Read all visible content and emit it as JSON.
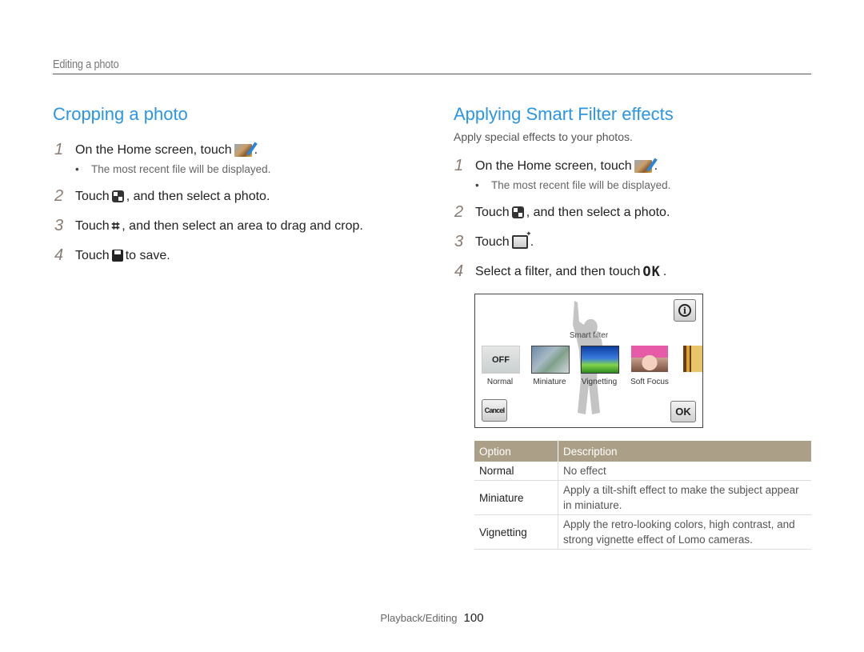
{
  "header": {
    "section": "Editing a photo"
  },
  "cropping": {
    "title": "Cropping a photo",
    "steps": [
      {
        "num": "1",
        "pre": "On the Home screen, touch",
        "icon": "gallery-icon",
        "post": ".",
        "sub": "The most recent file will be displayed."
      },
      {
        "num": "2",
        "pre": "Touch",
        "icon": "thumbnail-grid-icon",
        "post": ", and then select a photo."
      },
      {
        "num": "3",
        "pre": "Touch",
        "icon": "crop-icon",
        "post": ", and then select an area to drag and crop."
      },
      {
        "num": "4",
        "pre": "Touch",
        "icon": "save-icon",
        "post": " to save."
      }
    ]
  },
  "smart_filter": {
    "title": "Applying Smart Filter effects",
    "intro": "Apply special effects to your photos.",
    "steps": [
      {
        "num": "1",
        "pre": "On the Home screen, touch",
        "icon": "gallery-icon",
        "post": ".",
        "sub": "The most recent file will be displayed."
      },
      {
        "num": "2",
        "pre": "Touch",
        "icon": "thumbnail-grid-icon",
        "post": ", and then select a photo."
      },
      {
        "num": "3",
        "pre": "Touch",
        "icon": "smart-filter-icon",
        "post": "."
      },
      {
        "num": "4",
        "pre": "Select a filter, and then touch",
        "icon": "ok-glyph",
        "ok": "OK",
        "post": "."
      }
    ],
    "screen": {
      "title": "Smart filter",
      "off_label": "OFF",
      "filters": [
        "Normal",
        "Miniature",
        "Vignetting",
        "Soft Focus"
      ],
      "cancel": "Cancel",
      "ok": "OK",
      "info": "i"
    }
  },
  "options_table": {
    "headers": [
      "Option",
      "Description"
    ],
    "rows": [
      {
        "option": "Normal",
        "description": "No effect"
      },
      {
        "option": "Miniature",
        "description": "Apply a tilt-shift effect to make the subject appear in miniature."
      },
      {
        "option": "Vignetting",
        "description": "Apply the retro-looking colors, high contrast, and strong vignette effect of Lomo cameras."
      }
    ],
    "header_color": "#ab9f88"
  },
  "footer": {
    "section": "Playback/Editing",
    "page": "100"
  },
  "colors": {
    "title_blue": "#2b95e6",
    "step_number": "#8a7c72"
  }
}
